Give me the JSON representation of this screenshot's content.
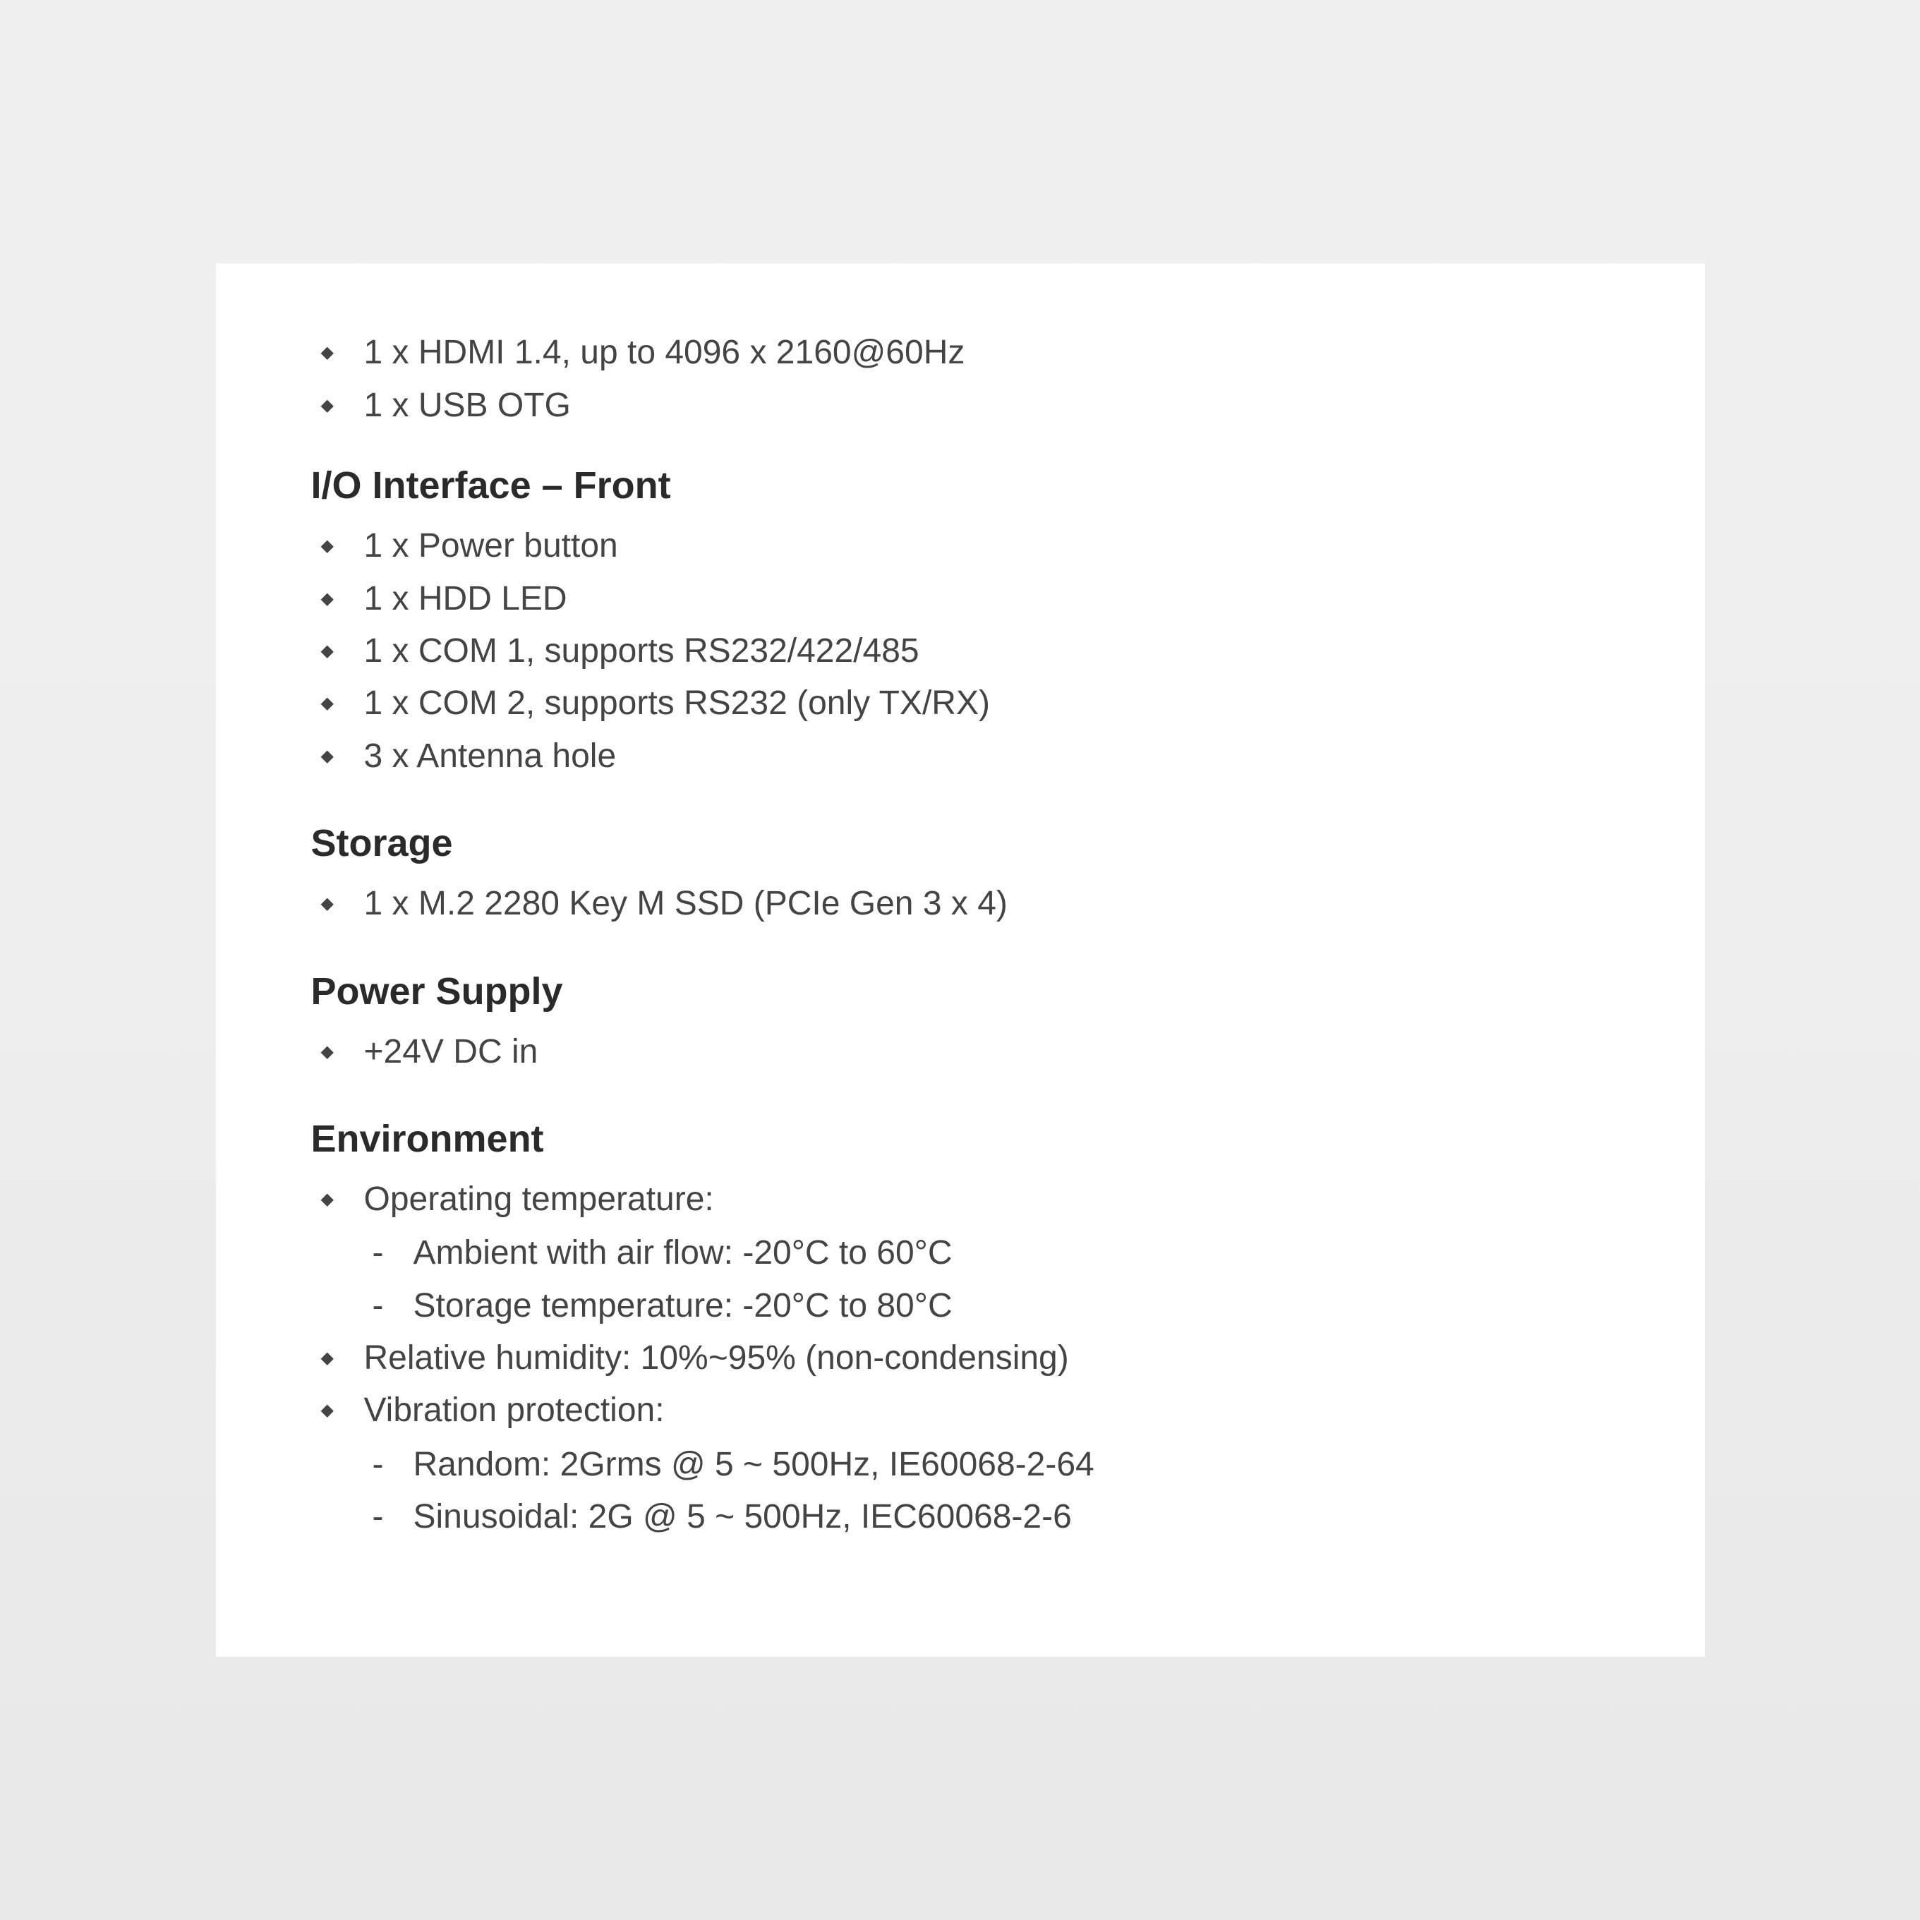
{
  "top_items": [
    "1 x HDMI 1.4, up to 4096 x 2160@60Hz",
    "1 x USB OTG"
  ],
  "sections": {
    "io_front": {
      "heading": "I/O Interface – Front",
      "items": [
        "1 x Power button",
        "1 x HDD LED",
        "1 x COM 1, supports RS232/422/485",
        "1 x COM 2, supports RS232 (only TX/RX)",
        "3 x Antenna hole"
      ]
    },
    "storage": {
      "heading": "Storage",
      "items": [
        "1 x M.2 2280 Key M SSD (PCIe Gen 3 x 4)"
      ]
    },
    "power_supply": {
      "heading": "Power Supply",
      "items": [
        "+24V DC in"
      ]
    },
    "environment": {
      "heading": "Environment",
      "items": [
        {
          "text": "Operating temperature:",
          "sub": [
            "Ambient with air flow: -20°C to 60°C",
            "Storage temperature: -20°C to 80°C"
          ]
        },
        {
          "text": "Relative humidity: 10%~95% (non-condensing)"
        },
        {
          "text": "Vibration protection:",
          "sub": [
            "Random: 2Grms @ 5 ~ 500Hz, IE60068-2-64",
            "Sinusoidal: 2G @ 5 ~ 500Hz, IEC60068-2-6"
          ]
        }
      ]
    }
  }
}
